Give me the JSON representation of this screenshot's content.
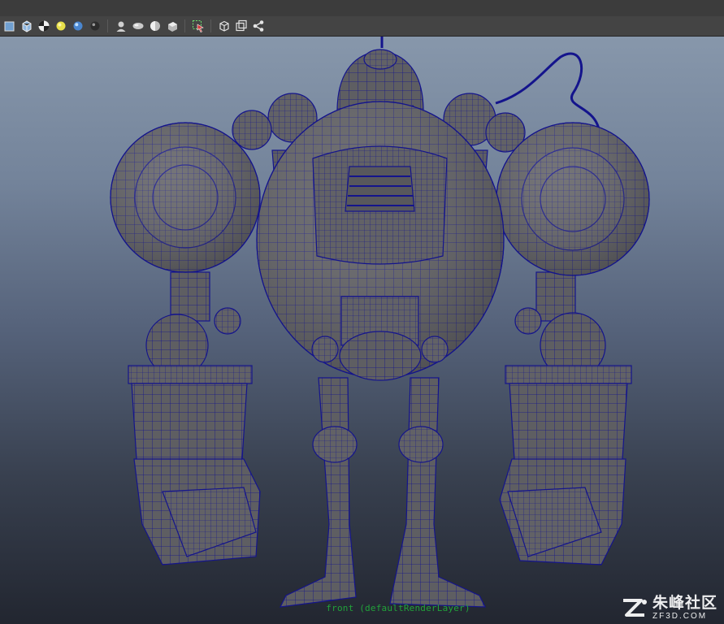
{
  "toolbar": {
    "icons": [
      "cube-small-icon",
      "wire-cube-icon",
      "checker-icon",
      "yellow-light-icon",
      "blue-sphere-icon",
      "dark-sphere-icon",
      "bust-icon",
      "shade-pill-icon",
      "half-sphere-icon",
      "shade-cube-icon",
      "select-highlight-icon",
      "isolate-cube-icon",
      "frame-cube-icon",
      "node-graph-icon"
    ],
    "colors": {
      "background": "#444444",
      "icon_light": "#d8d8d8",
      "accent_yellow": "#e8e04a",
      "accent_red": "#d13b3b"
    }
  },
  "viewport": {
    "camera_label": "front (defaultRenderLayer)",
    "label_color": "#21a23a",
    "wireframe_color": "#14148c",
    "mesh_color": "#5e5e62",
    "gradient_top": "#8797ab",
    "gradient_bottom": "#222630"
  },
  "watermark": {
    "chinese_text": "朱峰社区",
    "domain_text": "ZF3D.COM"
  }
}
